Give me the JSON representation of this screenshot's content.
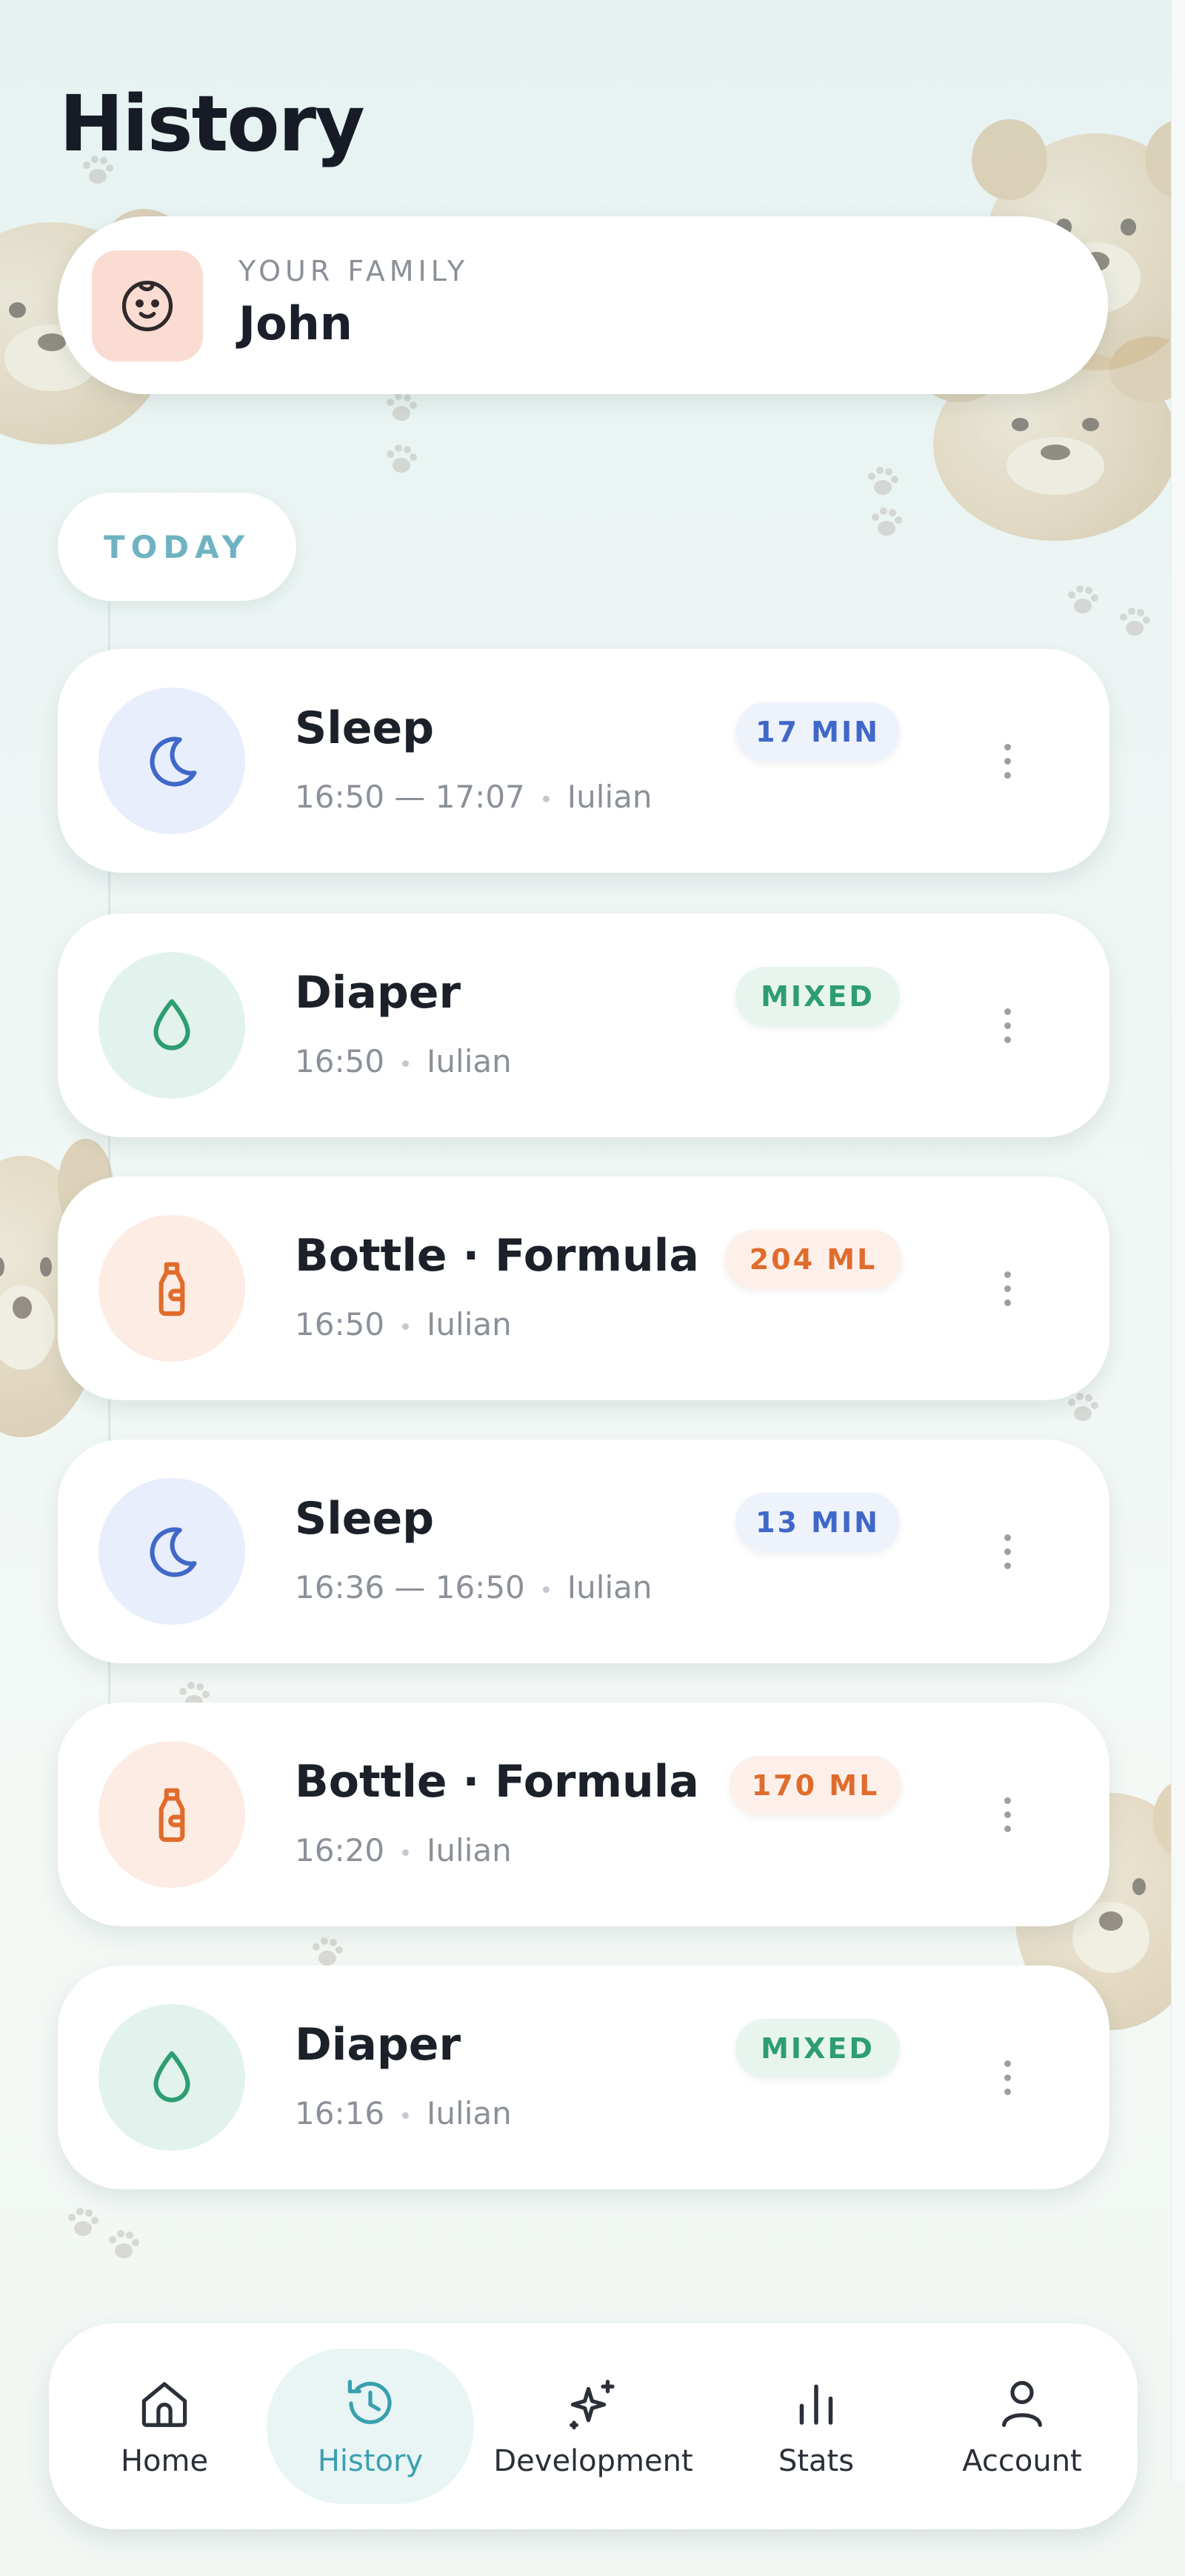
{
  "header": {
    "title": "History"
  },
  "family": {
    "label": "YOUR FAMILY",
    "name": "John",
    "avatar_icon": "baby-face-icon"
  },
  "section": {
    "today_label": "TODAY"
  },
  "entries": [
    {
      "type": "sleep",
      "icon": "moon-icon",
      "title": "Sleep",
      "time": "16:50 — 17:07",
      "author": "Iulian",
      "badge": "17 MIN",
      "badge_color": "#3f68c9"
    },
    {
      "type": "diaper",
      "icon": "droplet-icon",
      "title": "Diaper",
      "time": "16:50",
      "author": "Iulian",
      "badge": "MIXED",
      "badge_color": "#2e9e72"
    },
    {
      "type": "bottle",
      "icon": "bottle-icon",
      "title": "Bottle · Formula",
      "time": "16:50",
      "author": "Iulian",
      "badge": "204 ML",
      "badge_color": "#e06c2c"
    },
    {
      "type": "sleep",
      "icon": "moon-icon",
      "title": "Sleep",
      "time": "16:36 — 16:50",
      "author": "Iulian",
      "badge": "13 MIN",
      "badge_color": "#3f68c9"
    },
    {
      "type": "bottle",
      "icon": "bottle-icon",
      "title": "Bottle · Formula",
      "time": "16:20",
      "author": "Iulian",
      "badge": "170 ML",
      "badge_color": "#e06c2c"
    },
    {
      "type": "diaper",
      "icon": "droplet-icon",
      "title": "Diaper",
      "time": "16:16",
      "author": "Iulian",
      "badge": "MIXED",
      "badge_color": "#2e9e72"
    }
  ],
  "nav": {
    "items": [
      {
        "label": "Home",
        "icon": "house-icon",
        "active": false
      },
      {
        "label": "History",
        "icon": "history-icon",
        "active": true
      },
      {
        "label": "Development",
        "icon": "sparkle-icon",
        "active": false
      },
      {
        "label": "Stats",
        "icon": "bar-chart-icon",
        "active": false
      },
      {
        "label": "Account",
        "icon": "person-icon",
        "active": false
      }
    ]
  },
  "colors": {
    "accent": "#3a9fb0",
    "sleep": "#3f68c9",
    "diaper": "#2e9e72",
    "bottle": "#e06c2c"
  }
}
